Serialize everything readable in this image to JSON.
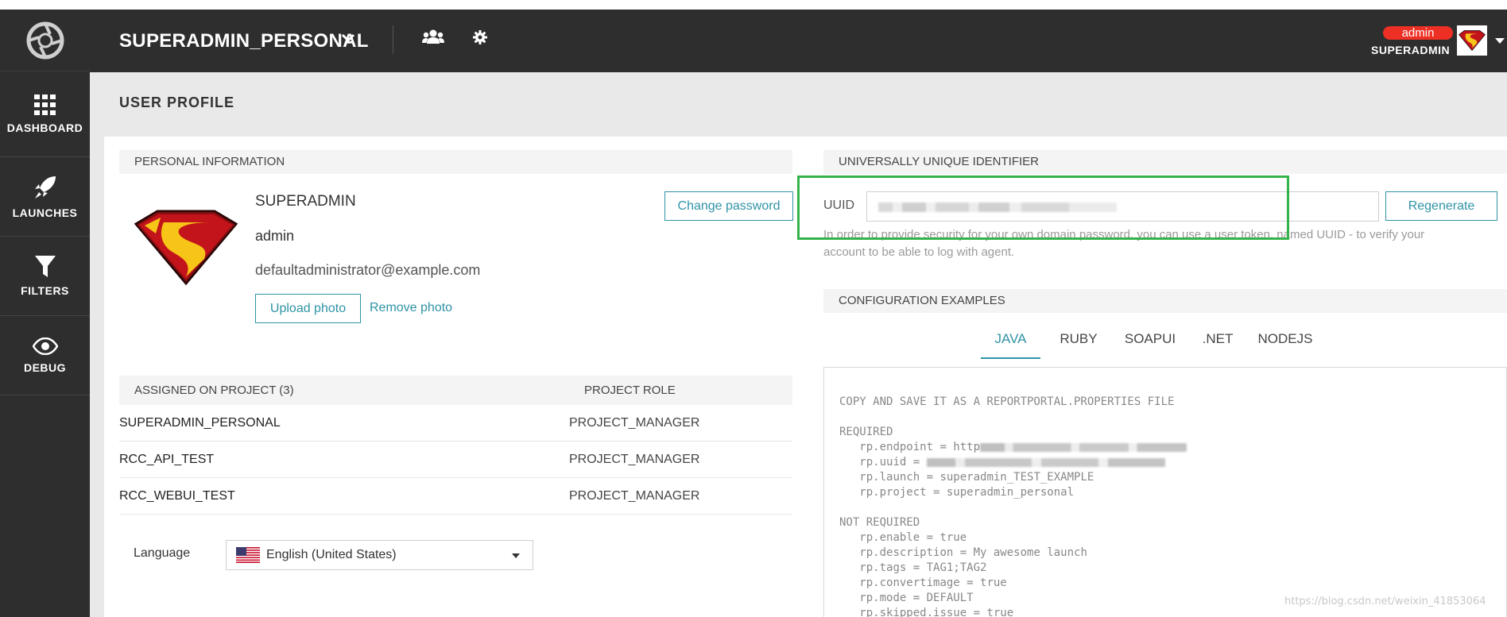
{
  "topbar": {
    "project_name": "SUPERADMIN_PERSONAL",
    "user_role_badge": "admin",
    "user_name": "SUPERADMIN"
  },
  "sidebar": {
    "items": [
      {
        "label": "DASHBOARD",
        "icon": "grid-icon"
      },
      {
        "label": "LAUNCHES",
        "icon": "rocket-icon"
      },
      {
        "label": "FILTERS",
        "icon": "funnel-icon"
      },
      {
        "label": "DEBUG",
        "icon": "eye-icon"
      }
    ]
  },
  "page": {
    "title": "USER PROFILE"
  },
  "personal": {
    "section_title": "PERSONAL INFORMATION",
    "full_name": "SUPERADMIN",
    "login": "admin",
    "email": "defaultadministrator@example.com",
    "change_password_label": "Change password",
    "upload_photo_label": "Upload photo",
    "remove_photo_label": "Remove photo"
  },
  "projects": {
    "header_project": "ASSIGNED ON PROJECT (3)",
    "header_role": "PROJECT ROLE",
    "rows": [
      {
        "name": "SUPERADMIN_PERSONAL",
        "role": "PROJECT_MANAGER"
      },
      {
        "name": "RCC_API_TEST",
        "role": "PROJECT_MANAGER"
      },
      {
        "name": "RCC_WEBUI_TEST",
        "role": "PROJECT_MANAGER"
      }
    ]
  },
  "language": {
    "label": "Language",
    "selected": "English (United States)"
  },
  "uuid": {
    "section_title": "UNIVERSALLY UNIQUE IDENTIFIER",
    "label": "UUID",
    "regenerate_label": "Regenerate",
    "help_text_line1": "In order to provide security for your own domain password, you can use a user token, named UUID - to verify your",
    "help_text_line2": "account to be able to log with agent."
  },
  "config": {
    "section_title": "CONFIGURATION EXAMPLES",
    "tabs": [
      "JAVA",
      "RUBY",
      "SOAPUI",
      ".NET",
      "NODEJS"
    ],
    "active_tab": "JAVA",
    "code": {
      "heading": "COPY AND SAVE IT AS A REPORTPORTAL.PROPERTIES FILE",
      "required_heading": "REQUIRED",
      "endpoint": "rp.endpoint = http",
      "uuid": "rp.uuid = ",
      "launch": "rp.launch = superadmin_TEST_EXAMPLE",
      "project": "rp.project = superadmin_personal",
      "not_required_heading": "NOT REQUIRED",
      "enable": "rp.enable = true",
      "description": "rp.description = My awesome launch",
      "tags": "rp.tags = TAG1;TAG2",
      "convertimage": "rp.convertimage = true",
      "mode": "rp.mode = DEFAULT",
      "skipped": "rp.skipped.issue = true"
    }
  },
  "watermark": "https://blog.csdn.net/weixin_41853064",
  "colors": {
    "accent": "#2f93a6",
    "dark_bg": "#2e2e2e",
    "badge_red": "#ed2f24",
    "highlight_green": "#33b34a"
  }
}
